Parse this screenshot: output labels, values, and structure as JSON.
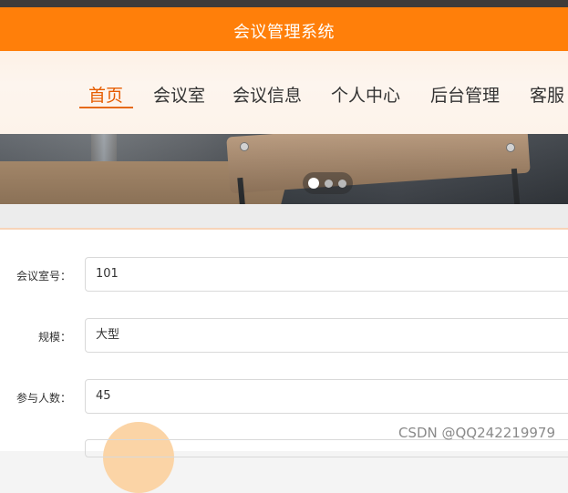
{
  "app": {
    "title": "会议管理系统"
  },
  "nav": {
    "items": [
      {
        "label": "首页",
        "active": true
      },
      {
        "label": "会议室",
        "active": false
      },
      {
        "label": "会议信息",
        "active": false
      },
      {
        "label": "个人中心",
        "active": false
      },
      {
        "label": "后台管理",
        "active": false
      },
      {
        "label": "客服",
        "active": false
      }
    ]
  },
  "banner": {
    "slides": 3,
    "active_slide": 1
  },
  "form": {
    "fields": [
      {
        "label": "会议室号：",
        "value": "101"
      },
      {
        "label": "规模：",
        "value": "大型"
      },
      {
        "label": "参与人数：",
        "value": "45"
      }
    ]
  },
  "watermark": "CSDN @QQ242219979",
  "colors": {
    "brand_orange": "#ff7f0a",
    "active_nav": "#e65c00"
  }
}
